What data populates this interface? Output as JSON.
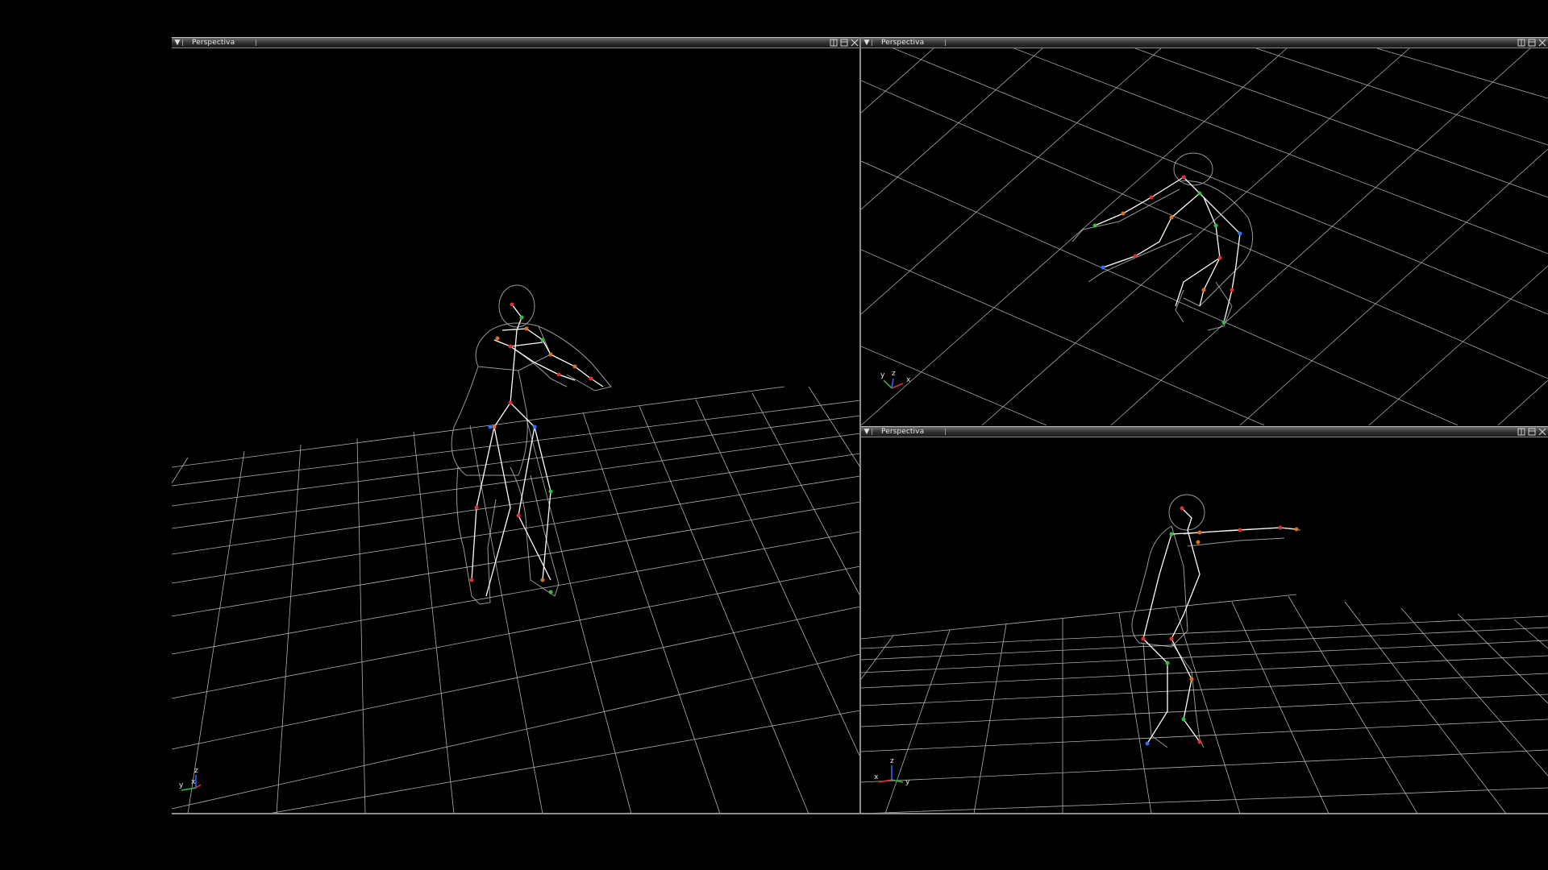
{
  "viewports": [
    {
      "title": "Perspectiva",
      "view": "main"
    },
    {
      "title": "Perspectiva",
      "view": "top-right"
    },
    {
      "title": "Perspectiva",
      "view": "bottom-right"
    }
  ],
  "axes_labels": {
    "x": "x",
    "y": "y",
    "z": "z"
  },
  "colors": {
    "background": "#000000",
    "grid": "#cfcfcf",
    "mesh": "#d8d8d8",
    "bone": "#ffffff",
    "joint_red": "#e03030",
    "joint_orange": "#e07020",
    "joint_green": "#30c040",
    "joint_blue": "#3070ff"
  },
  "icons": {
    "menu": "triangle-down-icon",
    "layout": "split-view-icon",
    "maximize": "maximize-icon",
    "close": "close-icon"
  }
}
